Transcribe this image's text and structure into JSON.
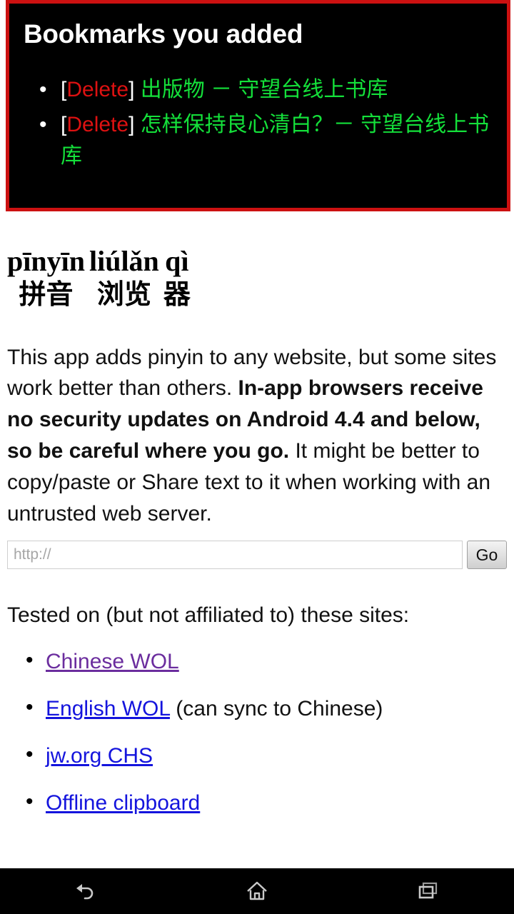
{
  "bookmarks_panel": {
    "title": "Bookmarks you added",
    "items": [
      {
        "open_bracket": "[",
        "delete_label": "Delete",
        "close_bracket": "]",
        "title": "出版物 － 守望台线上书库"
      },
      {
        "open_bracket": "[",
        "delete_label": "Delete",
        "close_bracket": "]",
        "title": "怎样保持良心清白？－ 守望台线上书库"
      }
    ],
    "colors": {
      "background": "#000000",
      "border": "#cc1111",
      "title": "#ffffff",
      "delete": "#dd1111",
      "bookmark_title": "#14e03a"
    }
  },
  "app_heading": {
    "ruby": [
      {
        "pinyin": "pīnyīn",
        "hanzi": "拼音"
      },
      {
        "pinyin": "liúlǎn",
        "hanzi": "浏览"
      },
      {
        "pinyin": "qì",
        "hanzi": "器"
      }
    ]
  },
  "intro": {
    "part1": "This app adds pinyin to any website, but some sites work better than others. ",
    "bold": "In-app browsers receive no security updates on Android 4.4 and below, so be careful where you go.",
    "part2": " It might be better to copy/paste or Share text to it when working with an untrusted web server."
  },
  "url_bar": {
    "placeholder": "http://",
    "value": "",
    "go_label": "Go"
  },
  "tested": {
    "label": "Tested on (but not affiliated to) these sites:",
    "sites": [
      {
        "link": "Chinese WOL",
        "note": "",
        "state": "visited"
      },
      {
        "link": "English WOL",
        "note": " (can sync to Chinese)",
        "state": "unvisited"
      },
      {
        "link": "jw.org CHS",
        "note": "",
        "state": "unvisited"
      },
      {
        "link": "Offline clipboard",
        "note": "",
        "state": "unvisited"
      }
    ]
  },
  "nav_bar": {
    "back": "back-icon",
    "home": "home-icon",
    "recents": "recents-icon"
  }
}
